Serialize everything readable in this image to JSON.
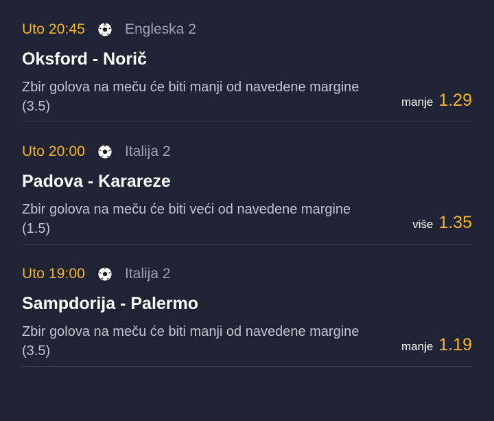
{
  "colors": {
    "background": "#1f2333",
    "accent": "#f6b624",
    "text_primary": "#ffffff",
    "text_secondary": "#c2c5cf",
    "text_muted": "#9da2b0",
    "divider": "#3a3f52"
  },
  "events": [
    {
      "time": "Uto 20:45",
      "sport_icon": "soccer-ball-icon",
      "league": "Engleska 2",
      "teams": "Oksford - Norič",
      "description": "Zbir golova na meču će biti manji od navedene margine (3.5)",
      "odd_label": "manje",
      "odd_value": "1.29"
    },
    {
      "time": "Uto 20:00",
      "sport_icon": "soccer-ball-icon",
      "league": "Italija 2",
      "teams": "Padova - Karareze",
      "description": "Zbir golova na meču će biti veći od navedene margine (1.5)",
      "odd_label": "više",
      "odd_value": "1.35"
    },
    {
      "time": "Uto 19:00",
      "sport_icon": "soccer-ball-icon",
      "league": "Italija 2",
      "teams": "Sampdorija - Palermo",
      "description": "Zbir golova na meču će biti manji od navedene margine (3.5)",
      "odd_label": "manje",
      "odd_value": "1.19"
    }
  ]
}
